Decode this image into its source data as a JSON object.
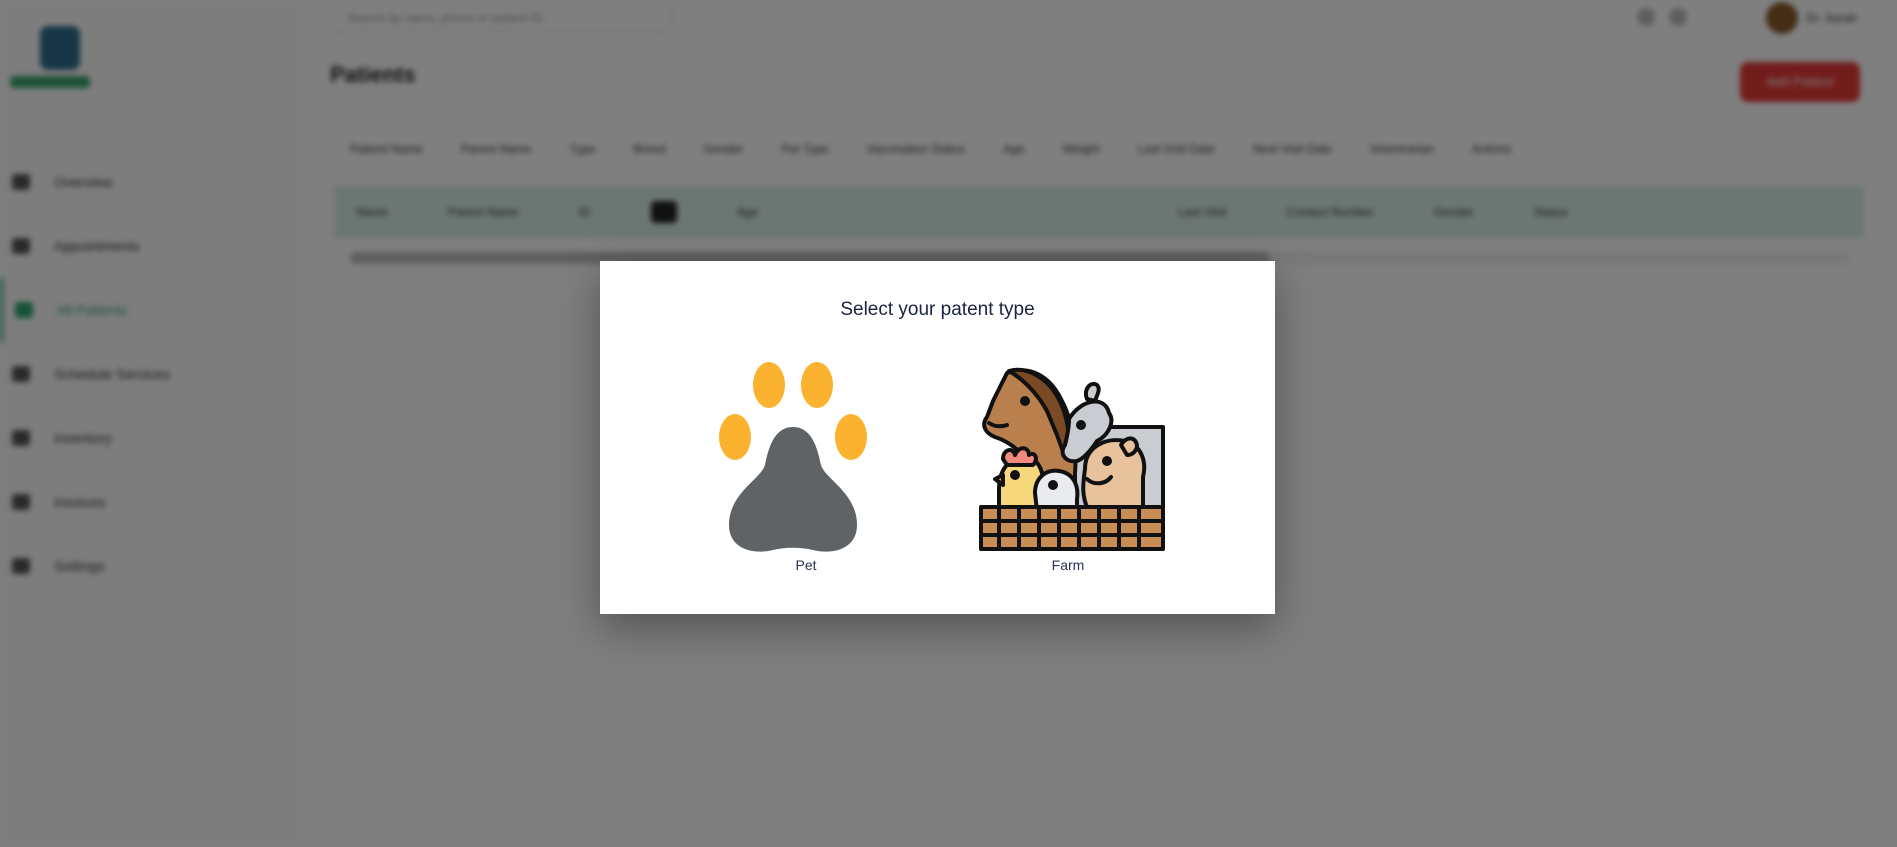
{
  "sidebar": {
    "items": [
      {
        "label": "Overview"
      },
      {
        "label": "Appointments"
      },
      {
        "label": "All Patients"
      },
      {
        "label": "Schedule Services"
      },
      {
        "label": "Inventory"
      },
      {
        "label": "Invoices"
      },
      {
        "label": "Settings"
      }
    ]
  },
  "topbar": {
    "search_placeholder": "Search by name, phone or patient ID",
    "user_name": "Dr. Sarah"
  },
  "page": {
    "title": "Patients",
    "add_button": "Add Patient"
  },
  "filters": [
    "Patient Name",
    "Parent Name",
    "Type",
    "Breed",
    "Gender",
    "Pet Type",
    "Vaccination Status",
    "Age",
    "Weight",
    "Last Visit Date",
    "Next Visit Date",
    "Veterinarian",
    "Actions"
  ],
  "table_columns": [
    "Name",
    "Parent Name",
    "ID",
    "",
    "Age",
    "",
    "",
    "Last Visit",
    "Contact Number",
    "Gender",
    "Status"
  ],
  "modal": {
    "title": "Select your patent type",
    "options": [
      {
        "label": "Pet"
      },
      {
        "label": "Farm"
      }
    ]
  },
  "colors": {
    "accent": "#2aa56c",
    "paw_toe": "#FBB32F",
    "paw_pad": "#5F6366",
    "danger": "#e53935"
  },
  "icons": {
    "pet": "paw-print-icon",
    "farm": "farm-animals-icon"
  }
}
